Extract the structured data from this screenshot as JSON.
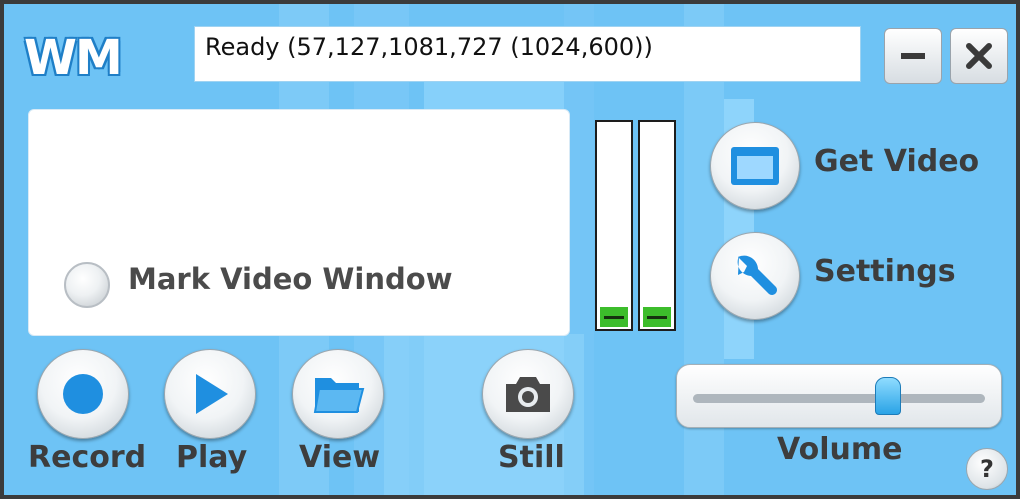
{
  "logo": {
    "text": "WM"
  },
  "status": {
    "text": "Ready (57,127,1081,727 (1024,600))"
  },
  "window_controls": {
    "minimize_icon": "minus-icon",
    "close_icon": "close-icon"
  },
  "video_panel": {
    "mark_label": "Mark Video Window",
    "mark_checked": false
  },
  "meters": {
    "left_level": 0.1,
    "right_level": 0.1,
    "fill_color": "#3cbd2b"
  },
  "actions": {
    "get_video": {
      "label": "Get Video",
      "icon": "window-icon"
    },
    "settings": {
      "label": "Settings",
      "icon": "wrench-icon"
    }
  },
  "bottom_buttons": {
    "record": {
      "label": "Record",
      "icon": "record-icon"
    },
    "play": {
      "label": "Play",
      "icon": "play-icon"
    },
    "view": {
      "label": "View",
      "icon": "folder-icon"
    },
    "still": {
      "label": "Still",
      "icon": "camera-icon"
    }
  },
  "volume": {
    "label": "Volume",
    "level": 0.68
  },
  "help": {
    "label": "?"
  },
  "colors": {
    "accent": "#1f8fe0",
    "background": "#6ec3f5"
  }
}
